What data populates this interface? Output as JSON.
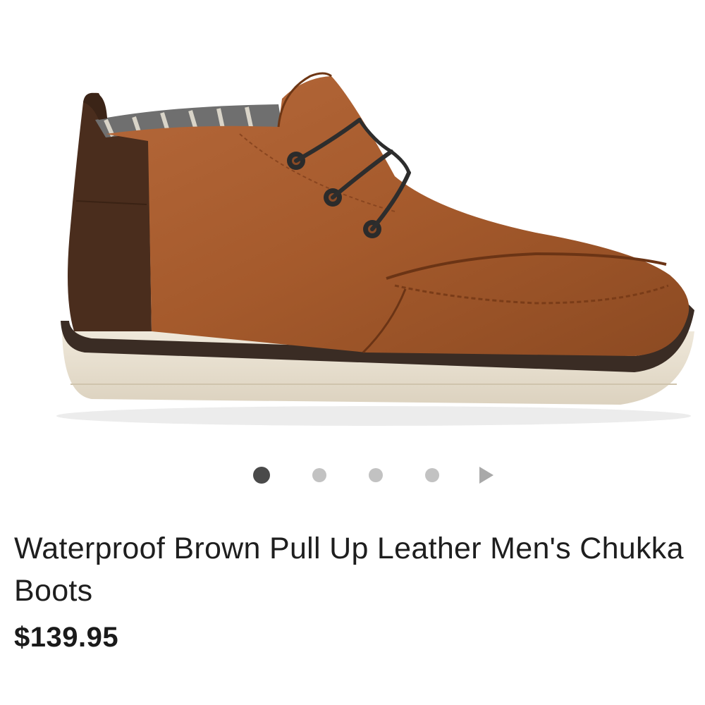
{
  "product": {
    "title": "Waterproof Brown Pull Up Leather Men's Chukka Boots",
    "price": "$139.95",
    "image_icon": "chukka-boot-photo"
  },
  "carousel": {
    "total_images": 4,
    "active_index": 0,
    "next_icon": "play-arrow-icon"
  },
  "colors": {
    "leather": "#a55a2c",
    "leather_dark": "#7d3f1a",
    "suede": "#4a2d1d",
    "sole": "#e8e0cf",
    "welt": "#3a2c24",
    "dot_active": "#4a4a4a",
    "dot_inactive": "#c2c2c2"
  }
}
